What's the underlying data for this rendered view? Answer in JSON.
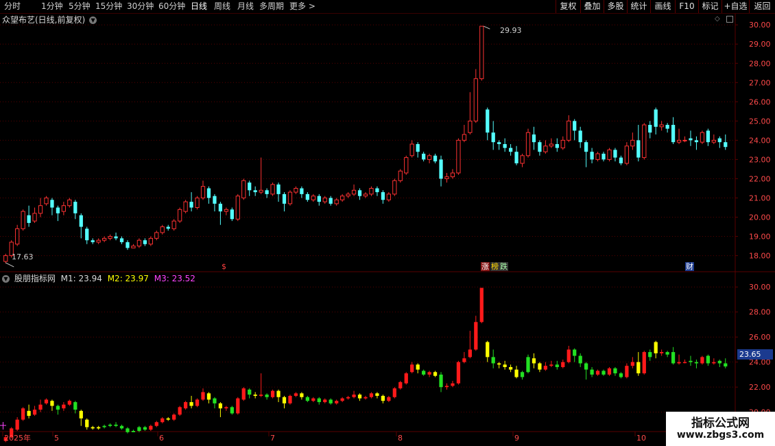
{
  "toolbar": {
    "periods": [
      "分时",
      "1分钟",
      "5分钟",
      "15分钟",
      "30分钟",
      "60分钟",
      "日线",
      "周线",
      "月线",
      "多周期",
      "更多 >"
    ],
    "buttons": [
      "复权",
      "叠加",
      "多股",
      "统计",
      "画线",
      "F10",
      "标记",
      "+自选",
      "返回"
    ]
  },
  "main_panel": {
    "title": "众望布艺(日线,前复权)",
    "high_label": "29.93",
    "low_label": "17.63",
    "y_ticks": [
      "30.00",
      "29.00",
      "28.00",
      "27.00",
      "26.00",
      "25.00",
      "24.00",
      "23.00",
      "22.00",
      "21.00",
      "20.00",
      "19.00",
      "18.00"
    ],
    "badges": {
      "dollar": "$",
      "zhang": "涨",
      "bang": "榜",
      "die": "跌",
      "cai": "财"
    }
  },
  "indicator_panel": {
    "name": "股朋指标网",
    "m1": "M1: 23.94",
    "m2": "M2: 23.97",
    "m3": "M3: 23.52",
    "y_ticks": [
      "30.00",
      "28.00",
      "26.00",
      "24.00",
      "22.00",
      "20.00"
    ],
    "current_value": "23.65"
  },
  "date_axis": {
    "labels": [
      "2025年",
      "5",
      "6",
      "7",
      "8",
      "9",
      "10"
    ]
  },
  "watermark": {
    "line1": "指标公式网",
    "line2": "www.zbgs3.com"
  },
  "colors": {
    "up": "#ff3232",
    "down": "#54ffff",
    "ind_red": "#ff1a1a",
    "ind_yellow": "#ffff00",
    "ind_green": "#22e022",
    "grid": "#5a0000",
    "axis_text": "#ff4a4a"
  },
  "chart_data": {
    "type": "candlestick",
    "price_range": [
      17.2,
      30.4
    ],
    "indicator_range": [
      18.5,
      31.0
    ],
    "ohlc": [
      [
        17.7,
        18.0,
        17.6,
        18.1
      ],
      [
        18.0,
        18.7,
        17.9,
        18.8
      ],
      [
        18.6,
        19.4,
        18.5,
        19.6
      ],
      [
        19.4,
        20.3,
        19.3,
        20.4
      ],
      [
        20.1,
        19.7,
        19.5,
        20.6
      ],
      [
        19.8,
        20.2,
        19.7,
        20.5
      ],
      [
        20.2,
        20.6,
        20.0,
        21.0
      ],
      [
        20.7,
        21.0,
        20.6,
        21.1
      ],
      [
        20.9,
        20.5,
        20.1,
        21.0
      ],
      [
        20.5,
        20.2,
        19.8,
        20.6
      ],
      [
        20.3,
        20.6,
        20.1,
        20.8
      ],
      [
        20.6,
        20.9,
        20.5,
        21.0
      ],
      [
        20.8,
        20.2,
        19.9,
        20.9
      ],
      [
        20.1,
        19.5,
        18.9,
        20.2
      ],
      [
        19.4,
        18.8,
        18.6,
        19.5
      ],
      [
        18.8,
        18.7,
        18.6,
        18.9
      ],
      [
        18.7,
        18.8,
        18.6,
        18.9
      ],
      [
        18.8,
        18.9,
        18.7,
        19.0
      ],
      [
        18.9,
        19.0,
        18.8,
        19.1
      ],
      [
        19.0,
        18.9,
        18.8,
        19.2
      ],
      [
        18.9,
        18.7,
        18.6,
        19.0
      ],
      [
        18.7,
        18.4,
        18.3,
        18.8
      ],
      [
        18.4,
        18.5,
        18.4,
        18.6
      ],
      [
        18.5,
        18.8,
        18.4,
        18.9
      ],
      [
        18.8,
        18.6,
        18.5,
        18.9
      ],
      [
        18.6,
        18.9,
        18.5,
        19.0
      ],
      [
        18.9,
        19.2,
        18.8,
        19.3
      ],
      [
        19.2,
        19.5,
        19.1,
        19.6
      ],
      [
        19.5,
        19.4,
        19.3,
        19.6
      ],
      [
        19.4,
        19.8,
        19.3,
        19.9
      ],
      [
        19.8,
        20.4,
        19.7,
        20.5
      ],
      [
        20.3,
        20.8,
        20.2,
        20.9
      ],
      [
        20.8,
        20.5,
        20.3,
        21.3
      ],
      [
        20.5,
        21.0,
        20.4,
        21.1
      ],
      [
        21.0,
        21.6,
        20.9,
        21.9
      ],
      [
        21.5,
        21.0,
        20.7,
        21.6
      ],
      [
        21.1,
        20.7,
        20.3,
        21.2
      ],
      [
        20.7,
        20.3,
        19.6,
        20.8
      ],
      [
        20.3,
        20.4,
        20.1,
        20.5
      ],
      [
        20.4,
        19.9,
        19.8,
        20.5
      ],
      [
        19.9,
        21.1,
        19.8,
        21.2
      ],
      [
        21.0,
        21.9,
        20.9,
        22.0
      ],
      [
        21.8,
        21.4,
        21.1,
        21.9
      ],
      [
        21.4,
        21.3,
        21.1,
        21.6
      ],
      [
        21.3,
        21.4,
        21.2,
        23.1
      ],
      [
        21.4,
        21.2,
        21.0,
        21.5
      ],
      [
        21.2,
        21.7,
        21.1,
        21.8
      ],
      [
        21.7,
        21.2,
        20.8,
        21.8
      ],
      [
        21.2,
        20.7,
        20.3,
        21.3
      ],
      [
        20.7,
        21.3,
        20.6,
        21.4
      ],
      [
        21.3,
        21.5,
        21.2,
        21.6
      ],
      [
        21.5,
        21.2,
        21.0,
        21.6
      ],
      [
        21.2,
        20.9,
        20.8,
        21.3
      ],
      [
        20.9,
        21.1,
        20.8,
        21.2
      ],
      [
        21.1,
        20.8,
        20.6,
        21.2
      ],
      [
        20.8,
        21.0,
        20.7,
        21.1
      ],
      [
        21.0,
        20.7,
        20.6,
        21.1
      ],
      [
        20.7,
        20.9,
        20.6,
        21.0
      ],
      [
        20.9,
        21.1,
        20.8,
        21.2
      ],
      [
        21.1,
        21.2,
        21.0,
        21.3
      ],
      [
        21.2,
        21.4,
        21.1,
        21.7
      ],
      [
        21.4,
        21.1,
        20.9,
        21.5
      ],
      [
        21.1,
        21.2,
        21.0,
        21.3
      ],
      [
        21.2,
        21.5,
        21.1,
        21.6
      ],
      [
        21.5,
        21.3,
        21.1,
        21.6
      ],
      [
        21.3,
        20.9,
        20.7,
        21.4
      ],
      [
        20.9,
        21.2,
        20.8,
        21.3
      ],
      [
        21.2,
        21.9,
        21.1,
        22.0
      ],
      [
        21.9,
        22.4,
        21.8,
        22.5
      ],
      [
        22.3,
        23.1,
        22.2,
        23.2
      ],
      [
        23.2,
        23.8,
        23.1,
        24.0
      ],
      [
        23.8,
        23.4,
        23.1,
        23.9
      ],
      [
        23.3,
        23.0,
        22.9,
        23.4
      ],
      [
        23.0,
        23.2,
        22.8,
        23.3
      ],
      [
        23.2,
        22.9,
        22.8,
        23.3
      ],
      [
        23.0,
        22.0,
        21.6,
        23.2
      ],
      [
        22.0,
        22.1,
        21.8,
        22.3
      ],
      [
        22.1,
        22.3,
        22.0,
        22.5
      ],
      [
        22.3,
        24.0,
        22.2,
        24.1
      ],
      [
        24.0,
        24.3,
        23.9,
        24.8
      ],
      [
        24.4,
        25.0,
        24.3,
        26.5
      ],
      [
        25.0,
        27.2,
        24.9,
        27.7
      ],
      [
        27.2,
        29.93,
        27.1,
        29.93
      ],
      [
        25.6,
        24.4,
        24.0,
        25.7
      ],
      [
        24.4,
        23.9,
        23.5,
        25.0
      ],
      [
        23.9,
        23.8,
        23.5,
        24.0
      ],
      [
        23.8,
        23.6,
        23.4,
        24.1
      ],
      [
        23.6,
        23.4,
        23.2,
        23.8
      ],
      [
        23.4,
        22.8,
        22.7,
        23.7
      ],
      [
        22.8,
        23.2,
        22.6,
        23.3
      ],
      [
        23.2,
        24.4,
        23.1,
        24.6
      ],
      [
        24.3,
        23.9,
        23.5,
        24.7
      ],
      [
        23.9,
        23.4,
        23.2,
        24.0
      ],
      [
        23.4,
        23.7,
        23.3,
        24.0
      ],
      [
        23.7,
        23.8,
        23.6,
        24.1
      ],
      [
        23.8,
        23.6,
        23.4,
        24.1
      ],
      [
        23.6,
        24.0,
        23.5,
        24.2
      ],
      [
        24.0,
        25.0,
        23.9,
        25.3
      ],
      [
        25.0,
        24.5,
        24.0,
        25.1
      ],
      [
        24.5,
        23.9,
        23.6,
        24.7
      ],
      [
        23.9,
        23.4,
        22.6,
        24.0
      ],
      [
        23.4,
        23.0,
        22.8,
        23.6
      ],
      [
        23.0,
        23.3,
        22.9,
        23.4
      ],
      [
        23.3,
        23.0,
        22.9,
        23.4
      ],
      [
        23.0,
        23.5,
        22.9,
        23.6
      ],
      [
        23.5,
        23.1,
        22.9,
        23.6
      ],
      [
        23.1,
        22.8,
        22.7,
        23.2
      ],
      [
        22.8,
        23.7,
        22.7,
        23.9
      ],
      [
        23.7,
        24.0,
        23.5,
        24.4
      ],
      [
        24.0,
        23.1,
        22.9,
        24.8
      ],
      [
        23.1,
        24.8,
        23.0,
        24.9
      ],
      [
        24.8,
        24.4,
        24.1,
        25.0
      ],
      [
        25.6,
        24.7,
        24.3,
        25.7
      ],
      [
        24.7,
        24.8,
        24.5,
        25.0
      ],
      [
        24.8,
        24.6,
        24.4,
        24.9
      ],
      [
        24.8,
        23.9,
        23.8,
        25.2
      ],
      [
        23.9,
        24.0,
        23.8,
        24.6
      ],
      [
        24.0,
        24.0,
        23.9,
        24.2
      ],
      [
        24.1,
        24.0,
        23.7,
        24.5
      ],
      [
        24.0,
        23.9,
        23.5,
        24.2
      ],
      [
        23.9,
        24.4,
        23.8,
        24.5
      ],
      [
        24.5,
        23.9,
        23.7,
        24.6
      ],
      [
        23.9,
        24.0,
        23.8,
        24.3
      ],
      [
        24.1,
        23.9,
        23.6,
        24.2
      ],
      [
        23.9,
        23.65,
        23.5,
        24.3
      ]
    ]
  }
}
